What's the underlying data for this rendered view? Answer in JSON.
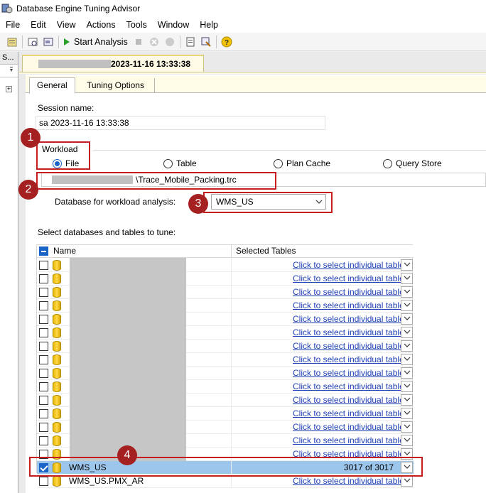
{
  "window": {
    "title": "Database Engine Tuning Advisor"
  },
  "menu": [
    "File",
    "Edit",
    "View",
    "Actions",
    "Tools",
    "Window",
    "Help"
  ],
  "toolbar": {
    "start_label": "Start Analysis"
  },
  "left_pane": {
    "header": "S..."
  },
  "session_tab": {
    "title": "2023-11-16 13:33:38"
  },
  "tabs": {
    "general": "General",
    "tuning_options": "Tuning Options"
  },
  "general": {
    "session_name_label": "Session name:",
    "session_name_value": "sa 2023-11-16 13:33:38",
    "workload_label": "Workload",
    "workload_options": [
      "File",
      "Table",
      "Plan Cache",
      "Query Store"
    ],
    "workload_selected": "File",
    "workload_file_path": "\\Trace_Mobile_Packing.trc",
    "db_for_workload_label": "Database for workload analysis:",
    "db_for_workload_value": "WMS_US",
    "select_db_label": "Select databases and tables to tune:"
  },
  "grid": {
    "headers": {
      "name": "Name",
      "selected_tables": "Selected Tables"
    },
    "link_text": "Click to select individual tables",
    "rows": [
      {
        "name": "",
        "checked": false,
        "selected": false,
        "tables": "link"
      },
      {
        "name": "",
        "checked": false,
        "selected": false,
        "tables": "link"
      },
      {
        "name": "",
        "checked": false,
        "selected": false,
        "tables": "link"
      },
      {
        "name": "",
        "checked": false,
        "selected": false,
        "tables": "link"
      },
      {
        "name": "",
        "checked": false,
        "selected": false,
        "tables": "link"
      },
      {
        "name": "",
        "checked": false,
        "selected": false,
        "tables": "link"
      },
      {
        "name": "",
        "checked": false,
        "selected": false,
        "tables": "link"
      },
      {
        "name": "",
        "checked": false,
        "selected": false,
        "tables": "link"
      },
      {
        "name": "",
        "checked": false,
        "selected": false,
        "tables": "link"
      },
      {
        "name": "",
        "checked": false,
        "selected": false,
        "tables": "link"
      },
      {
        "name": "",
        "checked": false,
        "selected": false,
        "tables": "link"
      },
      {
        "name": "",
        "checked": false,
        "selected": false,
        "tables": "link"
      },
      {
        "name": "",
        "checked": false,
        "selected": false,
        "tables": "link"
      },
      {
        "name": "",
        "checked": false,
        "selected": false,
        "tables": "link"
      },
      {
        "name": "",
        "checked": false,
        "selected": false,
        "tables": "link"
      },
      {
        "name": "WMS_US",
        "checked": true,
        "selected": true,
        "tables": "3017 of 3017"
      },
      {
        "name": "WMS_US.PMX_AR",
        "checked": false,
        "selected": false,
        "tables": "link"
      }
    ]
  },
  "annotations": [
    "1",
    "2",
    "3",
    "4"
  ],
  "colors": {
    "accent": "#1a64c8",
    "annotation": "#a52020",
    "highlight_row": "#9cc6ec",
    "link": "#1e3fb4"
  }
}
